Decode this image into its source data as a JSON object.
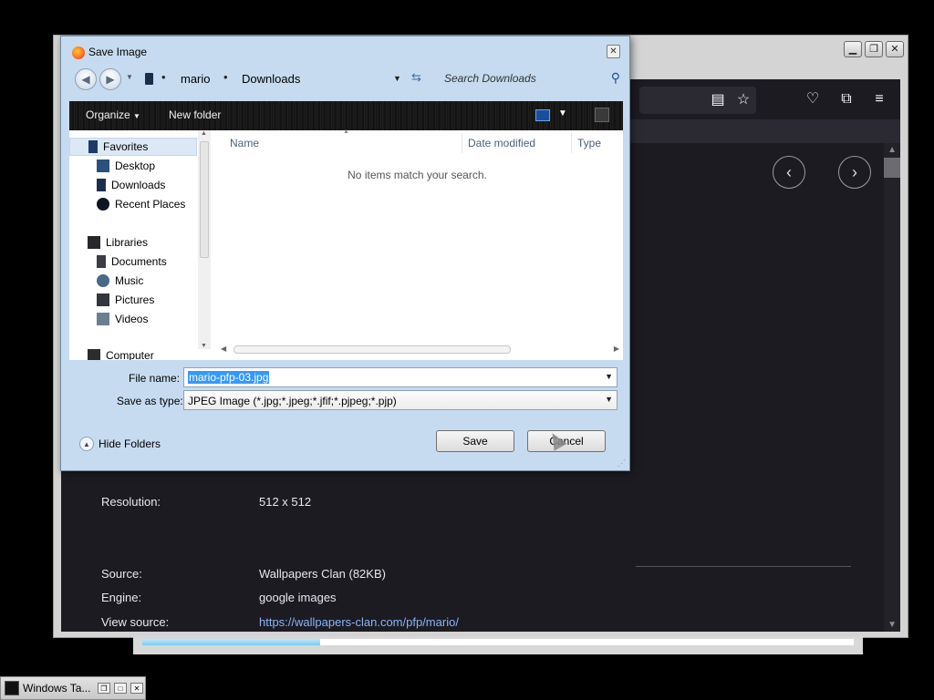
{
  "dialog": {
    "title": "Save Image",
    "breadcrumb": [
      "mario",
      "Downloads"
    ],
    "search_placeholder": "Search Downloads",
    "toolbar": {
      "organize": "Organize",
      "new_folder": "New folder"
    },
    "nav": {
      "favorites": "Favorites",
      "favorites_items": [
        "Desktop",
        "Downloads",
        "Recent Places"
      ],
      "libraries": "Libraries",
      "libraries_items": [
        "Documents",
        "Music",
        "Pictures",
        "Videos"
      ],
      "computer": "Computer"
    },
    "columns": [
      "Name",
      "Date modified",
      "Type"
    ],
    "empty_message": "No items match your search.",
    "file_name_label": "File name:",
    "file_name_value": "mario-pfp-03.jpg",
    "save_type_label": "Save as type:",
    "save_type_value": "JPEG Image (*.jpg;*.jpeg;*.jfif;*.pjpeg;*.pjp)",
    "hide_folders": "Hide Folders",
    "save_button": "Save",
    "cancel_button": "Cancel"
  },
  "browser": {
    "info": {
      "resolution_label": "Resolution:",
      "resolution_value": "512 x 512",
      "source_label": "Source:",
      "source_value": "Wallpapers Clan (82KB)",
      "engine_label": "Engine:",
      "engine_value": "google images",
      "view_source_label": "View source:",
      "view_source_value": "https://wallpapers-clan.com/pfp/mario/"
    },
    "progress_fraction": 0.25
  },
  "taskbar": {
    "label": "Windows Ta..."
  },
  "colors": {
    "link": "#8ab4f8",
    "selection": "#3399ff",
    "dialog_bg": "#c6dbef",
    "page_bg": "#1c1b22"
  }
}
